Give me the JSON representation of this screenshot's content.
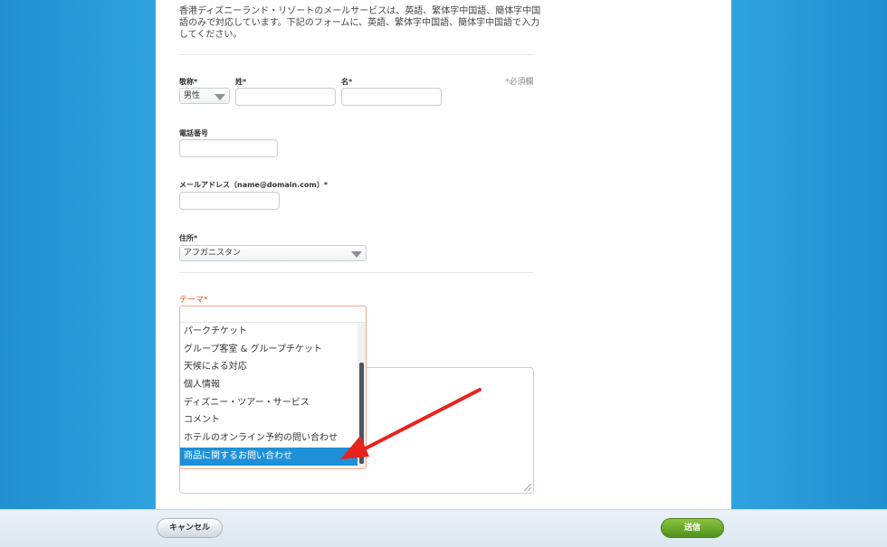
{
  "intro_text": "香港ディズニーランド・リゾートのメールサービスは、英語、繁体字中国語、簡体字中国語のみで対応しています。下記のフォームに、英語、繁体字中国語、簡体字中国語で入力してください。",
  "form": {
    "required_note": "*必須欄",
    "title_label": "敬称*",
    "title_value": "男性",
    "last_name_label": "姓*",
    "first_name_label": "名*",
    "phone_label": "電話番号",
    "email_label": "メールアドレス（name@domain.com）*",
    "address_label": "住所*",
    "address_value": "アフガニスタン",
    "theme_label": "テーマ*"
  },
  "theme_options": [
    "パークチケット",
    "グループ客室 & グループチケット",
    "天候による対応",
    "個人情報",
    "ディズニー・ツアー・サービス",
    "コメント",
    "ホテルのオンライン予約の問い合わせ",
    "商品に関するお問い合わせ"
  ],
  "theme_selected": "商品に関するお問い合わせ",
  "footer": {
    "cancel_label": "キャンセル",
    "send_label": "送信"
  },
  "colors": {
    "page_bg": "#2a9ad6",
    "accent_selected": "#1e90d8",
    "required_red": "#e2531b",
    "send_green": "#6aa82b",
    "annotation_arrow": "#e8231d"
  }
}
